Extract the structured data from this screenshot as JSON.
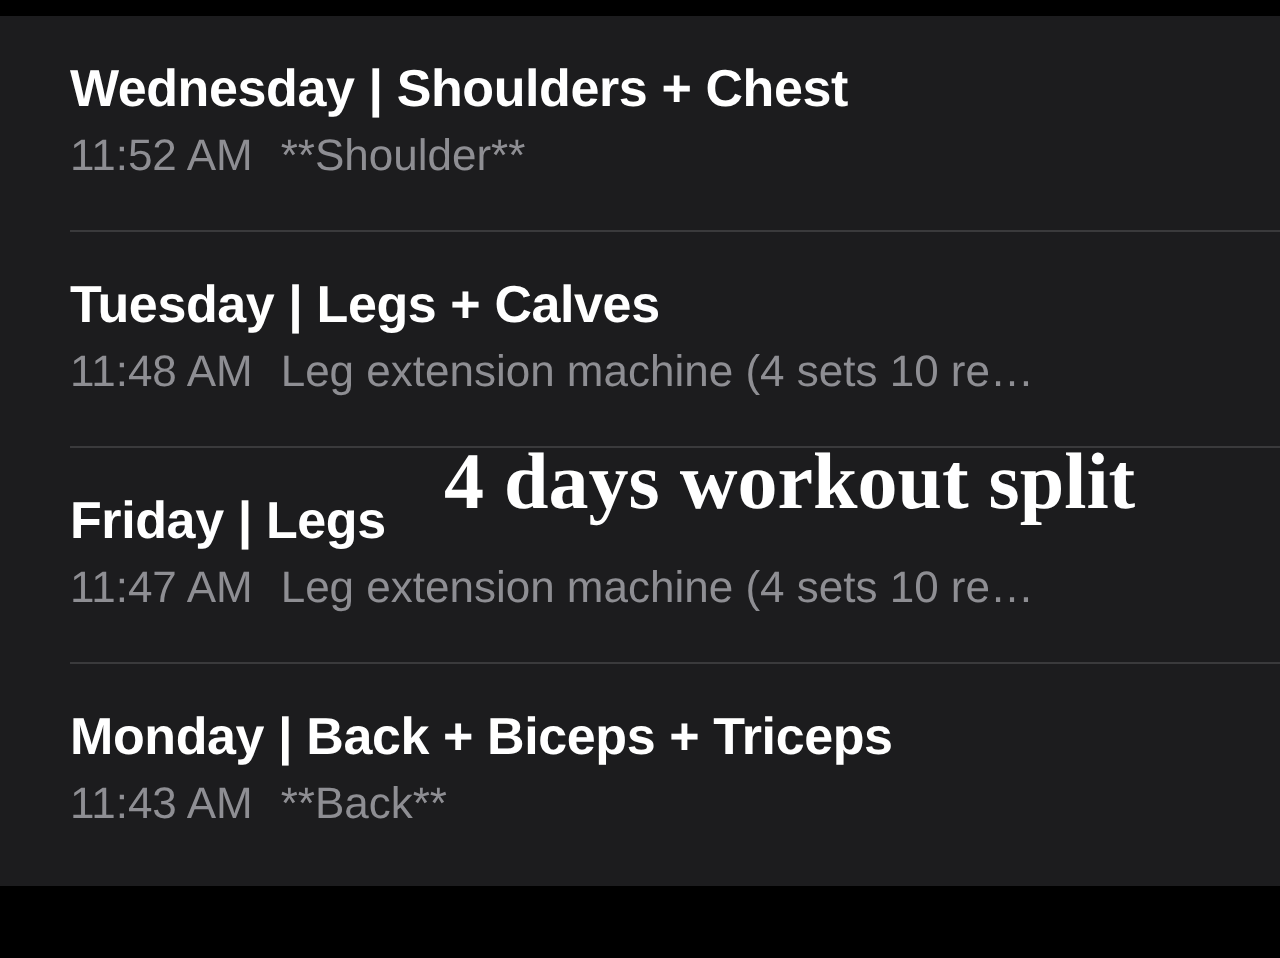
{
  "notes": [
    {
      "title": "Wednesday | Shoulders + Chest",
      "time": "11:52 AM",
      "preview": "**Shoulder**"
    },
    {
      "title": "Tuesday | Legs + Calves",
      "time": "11:48 AM",
      "preview": "Leg extension machine (4 sets 10 re…"
    },
    {
      "title": "Friday | Legs",
      "time": "11:47 AM",
      "preview": "Leg extension machine (4 sets 10 re…"
    },
    {
      "title": "Monday | Back + Biceps + Triceps",
      "time": "11:43 AM",
      "preview": "**Back**"
    }
  ],
  "caption": "4 days workout split"
}
